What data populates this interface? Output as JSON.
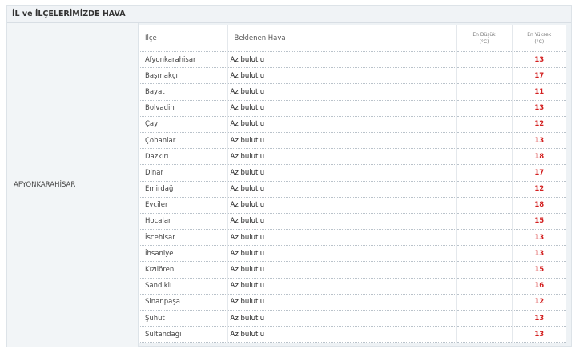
{
  "title": "İL ve İLÇELERİMİZDE HAVA",
  "province": "AFYONKARAHİSAR",
  "headers": {
    "district": "İlçe",
    "weather": "Beklenen Hava",
    "min_line1": "En Düşük",
    "min_line2": "(°C)",
    "max_line1": "En Yüksek",
    "max_line2": "(°C)"
  },
  "rows": [
    {
      "district": "Afyonkarahisar",
      "weather": "Az bulutlu",
      "min": "",
      "max": "13"
    },
    {
      "district": "Başmakçı",
      "weather": "Az bulutlu",
      "min": "",
      "max": "17"
    },
    {
      "district": "Bayat",
      "weather": "Az bulutlu",
      "min": "",
      "max": "11"
    },
    {
      "district": "Bolvadin",
      "weather": "Az bulutlu",
      "min": "",
      "max": "13"
    },
    {
      "district": "Çay",
      "weather": "Az bulutlu",
      "min": "",
      "max": "12"
    },
    {
      "district": "Çobanlar",
      "weather": "Az bulutlu",
      "min": "",
      "max": "13"
    },
    {
      "district": "Dazkırı",
      "weather": "Az bulutlu",
      "min": "",
      "max": "18"
    },
    {
      "district": "Dinar",
      "weather": "Az bulutlu",
      "min": "",
      "max": "17"
    },
    {
      "district": "Emirdağ",
      "weather": "Az bulutlu",
      "min": "",
      "max": "12"
    },
    {
      "district": "Evciler",
      "weather": "Az bulutlu",
      "min": "",
      "max": "18"
    },
    {
      "district": "Hocalar",
      "weather": "Az bulutlu",
      "min": "",
      "max": "15"
    },
    {
      "district": "İscehisar",
      "weather": "Az bulutlu",
      "min": "",
      "max": "13"
    },
    {
      "district": "İhsaniye",
      "weather": "Az bulutlu",
      "min": "",
      "max": "13"
    },
    {
      "district": "Kızılören",
      "weather": "Az bulutlu",
      "min": "",
      "max": "15"
    },
    {
      "district": "Sandıklı",
      "weather": "Az bulutlu",
      "min": "",
      "max": "16"
    },
    {
      "district": "Sinanpaşa",
      "weather": "Az bulutlu",
      "min": "",
      "max": "12"
    },
    {
      "district": "Şuhut",
      "weather": "Az bulutlu",
      "min": "",
      "max": "13"
    },
    {
      "district": "Sultandağı",
      "weather": "Az bulutlu",
      "min": "",
      "max": "13"
    }
  ],
  "colors": {
    "max_temp": "#d32020",
    "panel_bg": "#eef2f5"
  }
}
